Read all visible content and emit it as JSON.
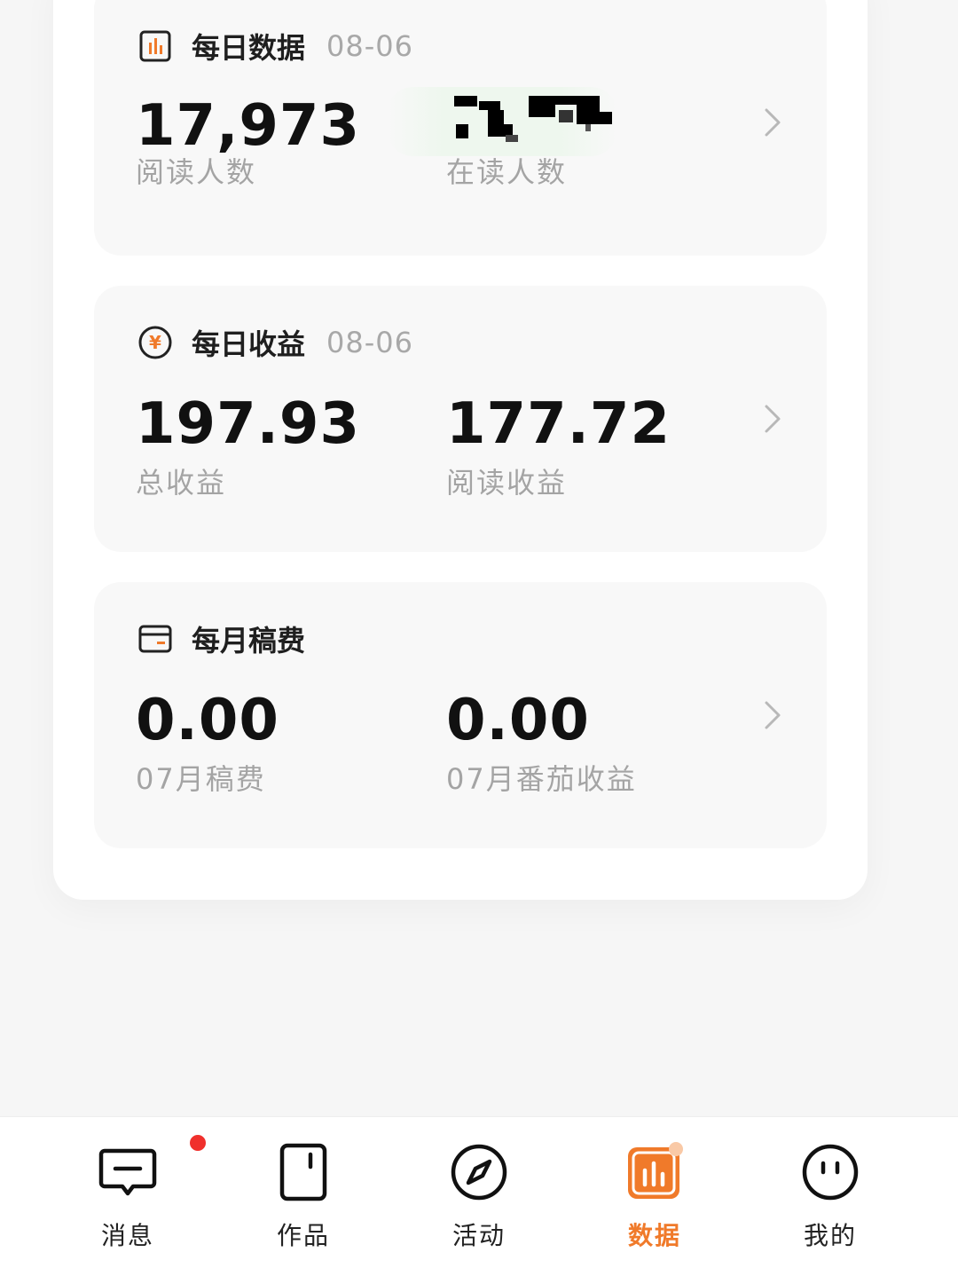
{
  "daily_data": {
    "title": "每日数据",
    "date": "08-06",
    "readers_value": "17,973",
    "readers_label": "阅读人数",
    "current_readers_label": "在读人数"
  },
  "daily_income": {
    "title": "每日收益",
    "date": "08-06",
    "total_value": "197.93",
    "total_label": "总收益",
    "read_value": "177.72",
    "read_label": "阅读收益"
  },
  "monthly_fee": {
    "title": "每月稿费",
    "fee_value": "0.00",
    "fee_label": "07月稿费",
    "fanqie_value": "0.00",
    "fanqie_label": "07月番茄收益"
  },
  "tabs": [
    {
      "label": "消息",
      "icon": "message-icon",
      "badge": true
    },
    {
      "label": "作品",
      "icon": "works-icon"
    },
    {
      "label": "活动",
      "icon": "compass-icon"
    },
    {
      "label": "数据",
      "icon": "data-chart-icon",
      "active": true
    },
    {
      "label": "我的",
      "icon": "profile-face-icon"
    }
  ],
  "colors": {
    "accent": "#f07a2a",
    "badge": "#f0302c"
  }
}
